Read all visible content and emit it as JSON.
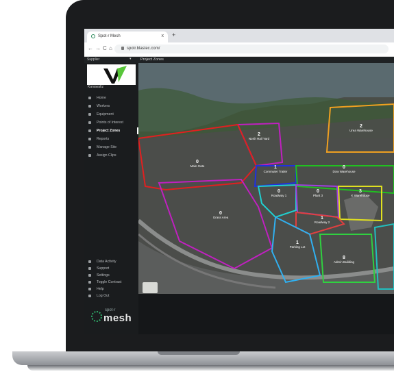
{
  "browser": {
    "tab_title": "Spot-r Mesh",
    "tab_close": "x",
    "new_tab": "+",
    "url": "spotr.blastec.com/",
    "nav": {
      "back": "←",
      "forward": "→",
      "reload": "C",
      "home": "⌂"
    }
  },
  "app": {
    "org_name": "Supplier",
    "org_caret": "▾",
    "page_title": "Project Zones",
    "brand_name": "Kanawaltz",
    "menu": [
      {
        "label": "Home",
        "icon": "home-icon"
      },
      {
        "label": "Workers",
        "icon": "person-icon"
      },
      {
        "label": "Equipment",
        "icon": "truck-icon"
      },
      {
        "label": "Points of Interest",
        "icon": "flag-icon"
      },
      {
        "label": "Project Zones",
        "icon": "zone-icon",
        "active": true
      },
      {
        "label": "Reports",
        "icon": "chart-icon"
      },
      {
        "label": "Manage Site",
        "icon": "site-icon"
      },
      {
        "label": "Assign Clips",
        "icon": "clip-icon"
      }
    ],
    "bottom_menu": [
      {
        "label": "Data Activity",
        "icon": "activity-icon"
      },
      {
        "label": "Support",
        "icon": "support-icon"
      },
      {
        "label": "Settings",
        "icon": "gear-icon"
      },
      {
        "label": "Toggle Contrast",
        "icon": "contrast-icon"
      },
      {
        "label": "Help",
        "icon": "help-icon"
      },
      {
        "label": "Log Out",
        "icon": "logout-icon"
      }
    ],
    "logo_line1": "spot-r",
    "logo_line2": "mesh"
  },
  "zones": [
    {
      "id": "north-rail-yard",
      "name": "North Rail Yard",
      "count": "2"
    },
    {
      "id": "urea-warehouse",
      "name": "Urea Warehouse",
      "count": "2"
    },
    {
      "id": "main-gate",
      "name": "Main Gate",
      "count": "0"
    },
    {
      "id": "commuter-trailer",
      "name": "Commuter Trailer",
      "count": "1"
    },
    {
      "id": "dow-warehouse",
      "name": "Dow Warehouse",
      "count": "0"
    },
    {
      "id": "roadway-1",
      "name": "Roadway 1",
      "count": "0"
    },
    {
      "id": "plant-3",
      "name": "Plant 3",
      "count": "0"
    },
    {
      "id": "k-warehouse",
      "name": "K Warehouse",
      "count": "3"
    },
    {
      "id": "grass-area",
      "name": "Grass Area",
      "count": "0"
    },
    {
      "id": "roadway-2",
      "name": "Roadway 2",
      "count": "1"
    },
    {
      "id": "parking-lot",
      "name": "Parking Lot",
      "count": "1"
    },
    {
      "id": "admin-building",
      "name": "Admin Building",
      "count": "8"
    }
  ],
  "zone_count_suffix": "○ 0"
}
